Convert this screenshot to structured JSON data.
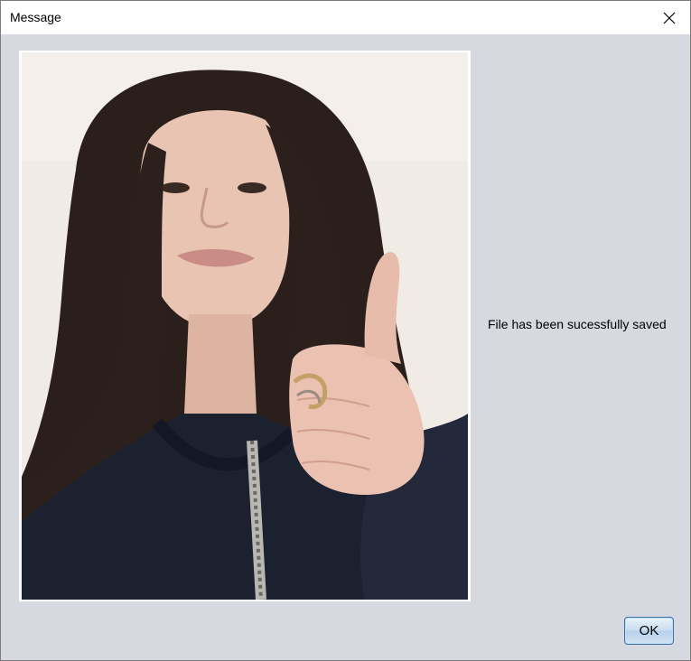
{
  "window": {
    "title": "Message",
    "close_icon": "close-icon"
  },
  "content": {
    "message": "File has been sucessfully saved",
    "image": {
      "description": "photo",
      "colors": {
        "wall": "#f3ece6",
        "hair": "#2a1e1a",
        "skin": "#e8bfae",
        "hoodie": "#1d2230"
      }
    }
  },
  "buttons": {
    "ok_label": "OK"
  },
  "colors": {
    "dialog_bg": "#d6d9e0",
    "titlebar_bg": "#ffffff",
    "button_border": "#3f6fa6"
  }
}
